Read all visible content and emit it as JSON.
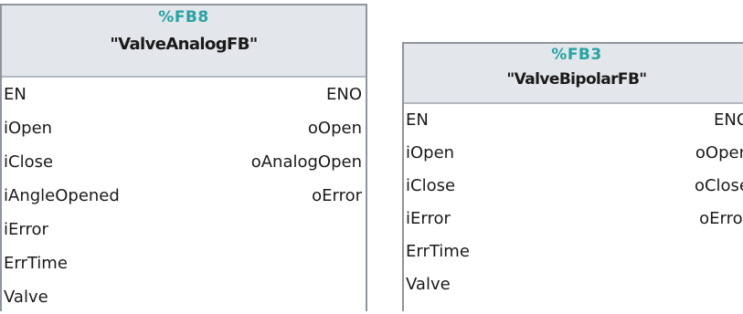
{
  "blocks": [
    {
      "instance": "%FB8",
      "type_name": "\"ValveAnalogFB\"",
      "inputs": [
        "EN",
        "iOpen",
        "iClose",
        "iAngleOpened",
        "iError",
        "ErrTime",
        "Valve"
      ],
      "outputs": [
        "ENO",
        "oOpen",
        "oAnalogOpen",
        "oError"
      ]
    },
    {
      "instance": "%FB3",
      "type_name": "\"ValveBipolarFB\"",
      "inputs": [
        "EN",
        "iOpen",
        "iClose",
        "iError",
        "ErrTime",
        "Valve"
      ],
      "outputs": [
        "ENO",
        "oOpen",
        "oClose",
        "oError"
      ]
    }
  ]
}
